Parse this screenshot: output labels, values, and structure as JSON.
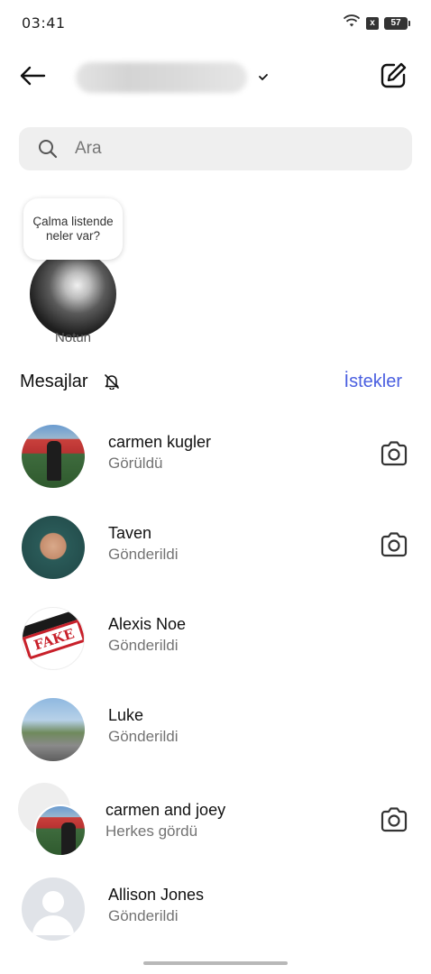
{
  "status_bar": {
    "time": "03:41",
    "battery": "57",
    "sim_indicator": "x"
  },
  "header": {
    "back_icon": "arrow-left-icon",
    "account_name": "",
    "chevron_icon": "chevron-down-icon",
    "compose_icon": "compose-icon"
  },
  "search": {
    "placeholder": "Ara",
    "icon": "search-icon"
  },
  "note": {
    "bubble_text": "Çalma listende neler var?",
    "label": "Notun"
  },
  "messages_section": {
    "title": "Mesajlar",
    "muted_icon": "bell-off-icon",
    "requests_label": "İstekler",
    "accent_color": "#4a5fe0"
  },
  "conversations": [
    {
      "name": "carmen kugler",
      "status": "Görüldü",
      "camera": true
    },
    {
      "name": "Taven",
      "status": "Gönderildi",
      "camera": true
    },
    {
      "name": "Alexis Noe",
      "status": "Gönderildi",
      "camera": false
    },
    {
      "name": "Luke",
      "status": "Gönderildi",
      "camera": false
    },
    {
      "name": "carmen and joey",
      "status": "Herkes gördü",
      "camera": true
    },
    {
      "name": "Allison Jones",
      "status": "Gönderildi",
      "camera": false
    }
  ],
  "avatar_stamp": "FAKE"
}
